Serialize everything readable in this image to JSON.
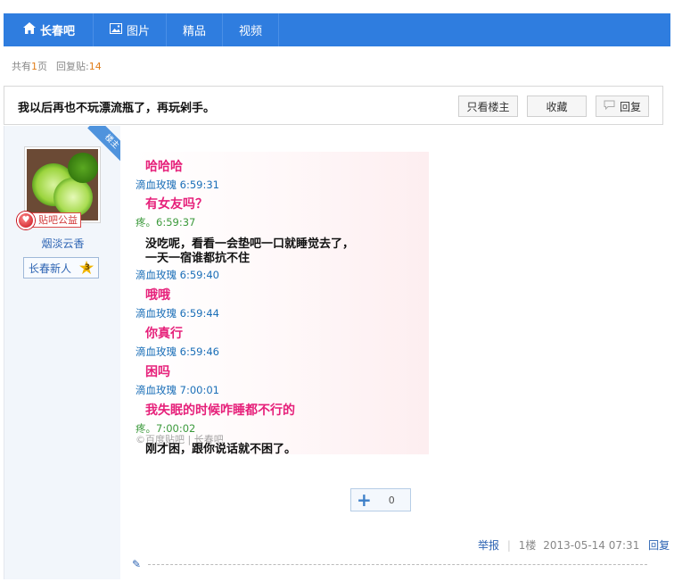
{
  "nav": {
    "home_label": "长春吧",
    "images_label": "图片",
    "featured_label": "精品",
    "video_label": "视频"
  },
  "meta": {
    "pages_prefix": "共有",
    "pages_num": "1",
    "pages_suffix": "页",
    "replies_prefix": "回复贴:",
    "replies_num": "14"
  },
  "topic": {
    "title": "我以后再也不玩漂流瓶了，再玩剁手。",
    "only_op_label": "只看楼主",
    "favorite_label": "收藏",
    "reply_label": "回复"
  },
  "author": {
    "corner_tag": "楼主",
    "badge": "贴吧公益",
    "name": "烟淡云香",
    "level_title": "长春新人",
    "level_num": "3"
  },
  "chat": [
    {
      "kind": "pink",
      "text": "哈哈哈"
    },
    {
      "kind": "blue",
      "text": "滴血玫瑰 6:59:31"
    },
    {
      "kind": "pink",
      "text": "有女友吗？"
    },
    {
      "kind": "green",
      "text": "疼。6:59:37"
    },
    {
      "kind": "black",
      "text": "没吃呢，看看一会垫吧一口就睡觉去了，"
    },
    {
      "kind": "black",
      "text": "一天一宿谁都抗不住"
    },
    {
      "kind": "blue",
      "text": "滴血玫瑰 6:59:40"
    },
    {
      "kind": "pink",
      "text": "哦哦"
    },
    {
      "kind": "blue",
      "text": "滴血玫瑰 6:59:44"
    },
    {
      "kind": "pink",
      "text": "你真行"
    },
    {
      "kind": "blue",
      "text": "滴血玫瑰 6:59:46"
    },
    {
      "kind": "pink",
      "text": "困吗"
    },
    {
      "kind": "blue",
      "text": "滴血玫瑰 7:00:01"
    },
    {
      "kind": "pink",
      "text": "我失眠的时候咋睡都不行的"
    },
    {
      "kind": "green",
      "text": "疼。7:00:02"
    },
    {
      "kind": "black",
      "text": "刚才困，跟你说话就不困了。"
    }
  ],
  "watermark": "©百度贴吧 | 长春吧",
  "like": {
    "count": "0"
  },
  "footer": {
    "report_label": "举报",
    "floor": "1楼",
    "date": "2013-05-14 07:31",
    "reply_label": "回复"
  },
  "colors": {
    "nav_blue": "#2f7ddf",
    "chat_pink": "#e6207a",
    "stamp_blue": "#1b6fb8",
    "stamp_green": "#3c9a3c"
  }
}
